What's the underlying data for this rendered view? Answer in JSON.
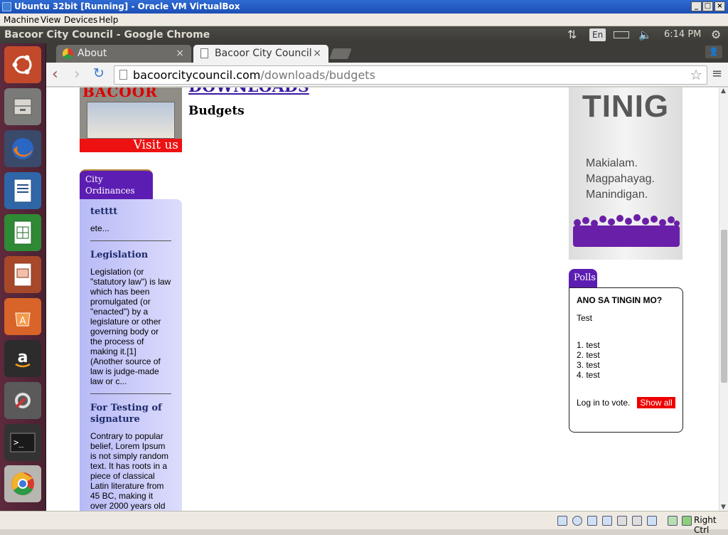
{
  "vbox": {
    "title": "Ubuntu 32bit [Running] - Oracle VM VirtualBox",
    "menu": [
      "Machine",
      "View",
      "Devices",
      "Help"
    ],
    "host_key": "Right Ctrl"
  },
  "ubuntu_panel": {
    "window_title": "Bacoor City Council - Google Chrome",
    "keyboard_layout": "En",
    "time": "6:14 PM"
  },
  "launcher": {
    "items": [
      "ubuntu-logo",
      "files",
      "firefox",
      "writer",
      "calc",
      "impress",
      "software-center",
      "amazon",
      "system-settings",
      "terminal",
      "chrome"
    ]
  },
  "chrome": {
    "tabs": [
      {
        "label": "About",
        "active": false
      },
      {
        "label": "Bacoor City Council",
        "active": true
      }
    ],
    "url_domain": "bacoorcitycouncil.com",
    "url_path": "/downloads/budgets"
  },
  "page": {
    "banner_logo_text": "BACOOR",
    "banner_visit": "Visit us",
    "downloads_heading": "DOWNLOADS",
    "budgets_heading": "Budgets",
    "ordinances": {
      "tab_label": "City Ordinances",
      "items": [
        {
          "title": "tetttt",
          "text": "ete..."
        },
        {
          "title": "Legislation",
          "text": "Legislation (or \"statutory law\") is law which has been promulgated (or \"enacted\") by a legislature or other governing body or the process of making it.[1] (Another source of law is judge-made law or c..."
        },
        {
          "title": "For Testing of signature",
          "text": "Contrary to popular belief, Lorem Ipsum is not simply random text. It has roots in a piece of classical Latin literature from 45 BC, making it over 2000 years old"
        }
      ]
    },
    "tinig": {
      "title": "TINIG",
      "slogan": [
        "Makialam.",
        "Magpahayag.",
        "Manindigan."
      ]
    },
    "polls": {
      "tab_label": "Polls",
      "question": "ANO SA TINGIN MO?",
      "description": "Test",
      "choices": [
        "1. test",
        "2. test",
        "3. test",
        "4. test"
      ],
      "login_text": "Log in to vote.",
      "show_all": "Show all"
    }
  },
  "colors": {
    "accent_purple": "#5c1db3",
    "panel_lavender": "#c6c8f8",
    "red": "#e00000"
  }
}
